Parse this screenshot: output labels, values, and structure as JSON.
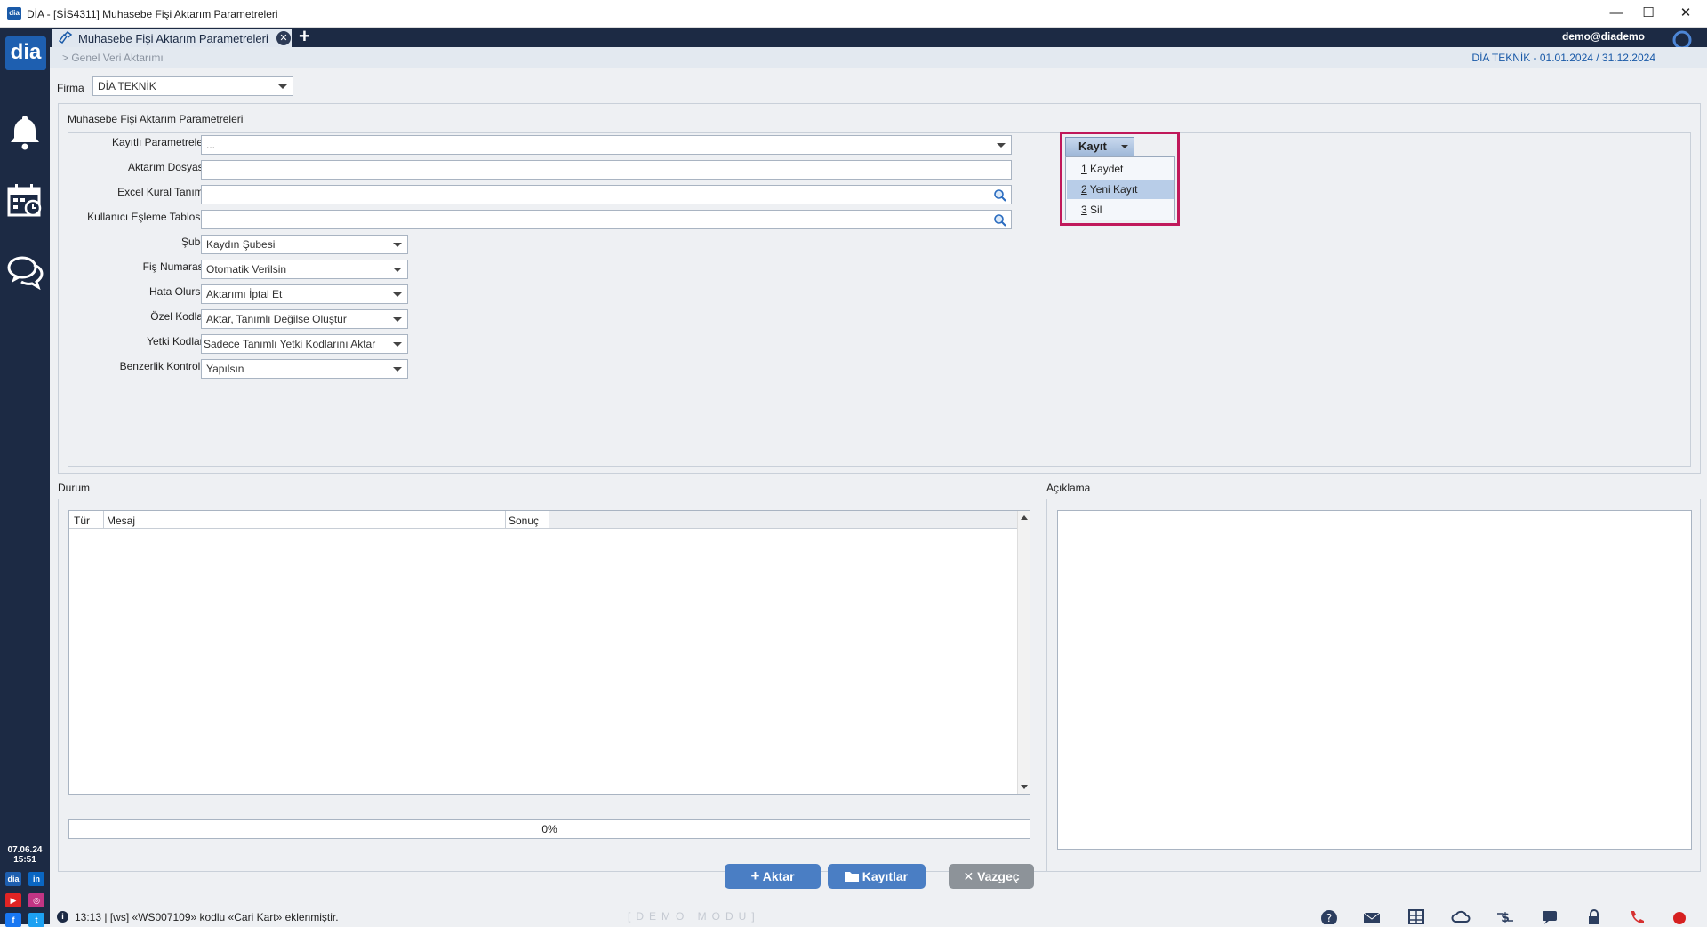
{
  "window": {
    "app_icon": "dia",
    "title": "DİA - [SİS4311] Muhasebe Fişi Aktarım Parametreleri",
    "controls": [
      "minimize-icon",
      "maximize-icon",
      "close-icon"
    ]
  },
  "sidebar": {
    "logo": "dia",
    "items": [
      "notification-bell-icon",
      "calendar-icon",
      "chat-icon"
    ],
    "date": "07.06.24",
    "time": "15:51",
    "social": [
      "dia",
      "in",
      "▶",
      "◎",
      "f",
      "t"
    ]
  },
  "tabs": {
    "active": "Muhasebe Fişi Aktarım Parametreleri",
    "add": "+",
    "user": "demo@diademo"
  },
  "subheader": {
    "breadcrumb": "> Genel Veri Aktarımı",
    "period": "DİA TEKNİK -  01.01.2024 / 31.12.2024"
  },
  "firma": {
    "label": "Firma",
    "value": "DİA TEKNİK"
  },
  "params": {
    "group_title": "Muhasebe Fişi Aktarım Parametreleri",
    "fields": [
      {
        "label": "Kayıtlı Parametreler",
        "value": "..."
      },
      {
        "label": "Aktarım Dosyası",
        "value": ""
      },
      {
        "label": "Excel Kural Tanımı",
        "value": ""
      },
      {
        "label": "Kullanıcı Eşleme Tablosu",
        "value": ""
      },
      {
        "label": "Şube",
        "value": "Kaydın Şubesi"
      },
      {
        "label": "Fiş Numarası",
        "value": "Otomatik Verilsin"
      },
      {
        "label": "Hata Olursa",
        "value": "Aktarımı İptal Et"
      },
      {
        "label": "Özel Kodlar",
        "value": "Aktar, Tanımlı Değilse Oluştur"
      },
      {
        "label": "Yetki Kodları",
        "value": "Sadece Tanımlı Yetki Kodlarını Aktar"
      },
      {
        "label": "Benzerlik Kontrolü",
        "value": "Yapılsın"
      }
    ]
  },
  "kayit": {
    "button": "Kayıt",
    "menu": [
      {
        "key": "1",
        "label": " Kaydet"
      },
      {
        "key": "2",
        "label": " Yeni Kayıt"
      },
      {
        "key": "3",
        "label": " Sil"
      }
    ]
  },
  "durum": {
    "label": "Durum",
    "columns": [
      "Tür",
      "Mesaj",
      "Sonuç"
    ],
    "progress": "0%",
    "progress_value": 0
  },
  "aciklama": {
    "label": "Açıklama"
  },
  "buttons": {
    "aktar": "Aktar",
    "kayitlar": "Kayıtlar",
    "vazgec": "Vazgeç"
  },
  "status": {
    "message": "13:13 | [ws] «WS007109» kodlu «Cari Kart» eklenmiştir.",
    "mode": "[DEMO MODU]",
    "icons": [
      "help-icon",
      "mail-icon",
      "calculator-icon",
      "cloud-sync-icon",
      "currency-icon",
      "chat-icon",
      "lock-icon",
      "phone-icon",
      "record-icon"
    ]
  },
  "colors": {
    "sidebar": "#1c2a44",
    "accent": "#1a5aa8",
    "highlight_border": "#c0185a",
    "button_blue": "#4a7ec4",
    "button_gray": "#8d9399"
  }
}
